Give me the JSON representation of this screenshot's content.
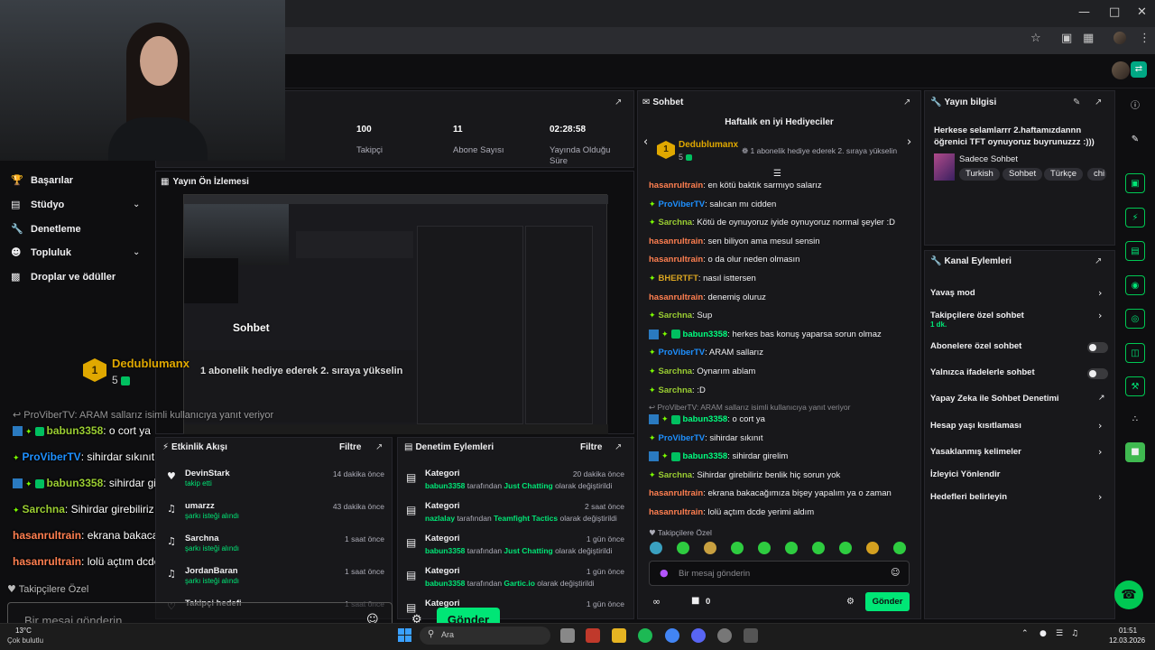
{
  "stats": [
    {
      "value": "100",
      "label": "Takipçi"
    },
    {
      "value": "11",
      "label": "Abone Sayısı"
    },
    {
      "value": "02:28:58",
      "label": "Yayında Olduğu Süre"
    }
  ],
  "nav": [
    {
      "label": "Başarılar",
      "icon": "trophy-icon",
      "chev": false
    },
    {
      "label": "Stüdyo",
      "icon": "film-icon",
      "chev": true
    },
    {
      "label": "Denetleme",
      "icon": "wrench-icon",
      "chev": false
    },
    {
      "label": "Topluluk",
      "icon": "users-icon",
      "chev": true
    },
    {
      "label": "Droplar ve ödüller",
      "icon": "gift-icon",
      "chev": false
    }
  ],
  "preview_title": "Yayın Ön İzlemesi",
  "preview_overlay": {
    "chat_label": "Sohbet",
    "gifter": "Dedublumanx",
    "gifter_count": "5",
    "rank_text": "1 abonelik hediye ederek 2. sıraya yükselin"
  },
  "overlay_chat": [
    {
      "user": "ProViberTV",
      "text": ": ARAM sallarız isimli kullanıcıya yanıt veriyor"
    },
    {
      "user": "babun3358",
      "text": ": o cort ya"
    },
    {
      "user": "ProViberTV",
      "text": ": sihirdar sıkınıt"
    },
    {
      "user": "babun3358",
      "text": ": sihirdar girelim"
    },
    {
      "user": "Sarchna",
      "text": ": Sihirdar girebiliriz benlik hiç sorun yok"
    },
    {
      "user": "hasanrultrain",
      "text": ": ekrana bakacağımıza bişey yapalım ya o zaman"
    },
    {
      "user": "hasanrultrain",
      "text": ": lolü açtım dcde yerimi aldım"
    }
  ],
  "overlay_bottom": {
    "followers_only": "Takipçilere Özel",
    "placeholder": "Bir mesaj gönderin",
    "send": "Gönder"
  },
  "events": {
    "title": "Etkinlik Akışı",
    "filter": "Filtre",
    "items": [
      {
        "name": "DevinStark",
        "time": "14 dakika önce",
        "sub": "takip etti"
      },
      {
        "name": "umarzz",
        "time": "43 dakika önce",
        "sub": "şarkı isteği alındı"
      },
      {
        "name": "Sarchna",
        "time": "1 saat önce",
        "sub": "şarkı isteği alındı"
      },
      {
        "name": "JordanBaran",
        "time": "1 saat önce",
        "sub": "şarkı isteği alındı"
      },
      {
        "name": "Takipçi hedefi",
        "time": "1 saat önce",
        "sub": ""
      }
    ]
  },
  "mod": {
    "title": "Denetim Eylemleri",
    "filter": "Filtre",
    "items": [
      {
        "title": "Kategori",
        "time": "20 dakika önce",
        "user": "babun3358",
        "mid": " tarafından ",
        "cat": "Just Chatting",
        "end": " olarak değiştirildi"
      },
      {
        "title": "Kategori",
        "time": "2 saat önce",
        "user": "nazlalay",
        "mid": " tarafından ",
        "cat": "Teamfight Tactics",
        "end": " olarak değiştirildi"
      },
      {
        "title": "Kategori",
        "time": "1 gün önce",
        "user": "babun3358",
        "mid": " tarafından ",
        "cat": "Just Chatting",
        "end": " olarak değiştirildi"
      },
      {
        "title": "Kategori",
        "time": "1 gün önce",
        "user": "babun3358",
        "mid": " tarafından ",
        "cat": "Gartic.io",
        "end": " olarak değiştirildi"
      },
      {
        "title": "Kategori",
        "time": "1 gün önce",
        "user": "",
        "mid": "",
        "cat": "",
        "end": ""
      }
    ]
  },
  "chat": {
    "title": "Sohbet",
    "gifters_title": "Haftalık en iyi Hediyeciler",
    "gifter": "Dedublumanx",
    "gifter_count": "5",
    "rank_text": "1 abonelik hediye ederek 2. sıraya yükselin",
    "messages": [
      {
        "user": "hasanrultrain",
        "color": "orange",
        "text": ": en kötü baktık sarmıyo salarız"
      },
      {
        "user": "ProViberTV",
        "color": "blue",
        "text": ": salıcan mı cidden"
      },
      {
        "user": "Sarchna",
        "color": "green",
        "text": ": Kötü de oynuyoruz iyide oynuyoruz normal şeyler :D"
      },
      {
        "user": "hasanrultrain",
        "color": "orange",
        "text": ": sen biliyon ama mesul sensin"
      },
      {
        "user": "hasanrultrain",
        "color": "orange",
        "text": ": o da olur neden olmasın"
      },
      {
        "user": "BHERTFT",
        "color": "yellow",
        "text": ": nasıl isttersen"
      },
      {
        "user": "hasanrultrain",
        "color": "orange",
        "text": ": denemiş oluruz"
      },
      {
        "user": "Sarchna",
        "color": "green",
        "text": ": Sup"
      },
      {
        "user": "babun3358",
        "color": "lime",
        "text": ": herkes bas konuş yaparsa sorun olmaz"
      },
      {
        "user": "ProViberTV",
        "color": "blue",
        "text": ": ARAM sallarız"
      },
      {
        "user": "Sarchna",
        "color": "green",
        "text": ": Oynarım ablam"
      },
      {
        "user": "Sarchna",
        "color": "green",
        "text": ": :D"
      }
    ],
    "reply_note": "ProViberTV: ARAM sallarız isimli kullanıcıya yanıt veriyor",
    "messages2": [
      {
        "user": "babun3358",
        "color": "lime",
        "text": ": o cort ya"
      },
      {
        "user": "ProViberTV",
        "color": "blue",
        "text": ": sihirdar sıkınıt"
      },
      {
        "user": "babun3358",
        "color": "lime",
        "text": ": sihirdar girelim"
      },
      {
        "user": "Sarchna",
        "color": "green",
        "text": ": Sihirdar girebiliriz benlik hiç sorun yok"
      },
      {
        "user": "hasanrultrain",
        "color": "orange",
        "text": ": ekrana bakacağımıza bişey yapalım ya o zaman"
      },
      {
        "user": "hasanrultrain",
        "color": "orange",
        "text": ": lolü açtım dcde yerimi aldım"
      }
    ],
    "followers_only": "Takipçilere Özel",
    "placeholder": "Bir mesaj gönderin",
    "points": "0",
    "send": "Gönder"
  },
  "stream_info": {
    "title": "Yayın bilgisi",
    "stream_title": "Herkese selamlarrr 2.haftamızdannn öğrenici TFT oynuyoruz buyrunuzzz :)))",
    "category": "Sadece Sohbet",
    "tags": [
      "Turkish",
      "Sohbet",
      "Türkçe",
      "chi"
    ]
  },
  "channel_actions": {
    "title": "Kanal Eylemleri",
    "items": [
      {
        "label": "Yavaş mod",
        "kind": "chev",
        "sub": ""
      },
      {
        "label": "Takipçilere özel sohbet",
        "kind": "chev",
        "sub": "1 dk."
      },
      {
        "label": "Abonelere özel sohbet",
        "kind": "toggle",
        "sub": ""
      },
      {
        "label": "Yalnızca ifadelerle sohbet",
        "kind": "toggle",
        "sub": ""
      },
      {
        "label": "Yapay Zeka ile Sohbet Denetimi",
        "kind": "ext",
        "sub": ""
      },
      {
        "label": "Hesap yaşı kısıtlaması",
        "kind": "chev",
        "sub": ""
      },
      {
        "label": "Yasaklanmış kelimeler",
        "kind": "chev",
        "sub": ""
      },
      {
        "label": "İzleyici Yönlendir",
        "kind": "none",
        "sub": ""
      },
      {
        "label": "Hedefleri belirleyin",
        "kind": "chev",
        "sub": ""
      }
    ]
  },
  "taskbar": {
    "weather_temp": "13°C",
    "weather_desc": "Çok bulutlu",
    "search": "Ara",
    "time": "01:51",
    "date": "12.03.2026"
  },
  "colors": {
    "accent": "#00e676",
    "bg": "#0e0e10",
    "panel": "#18181b"
  }
}
